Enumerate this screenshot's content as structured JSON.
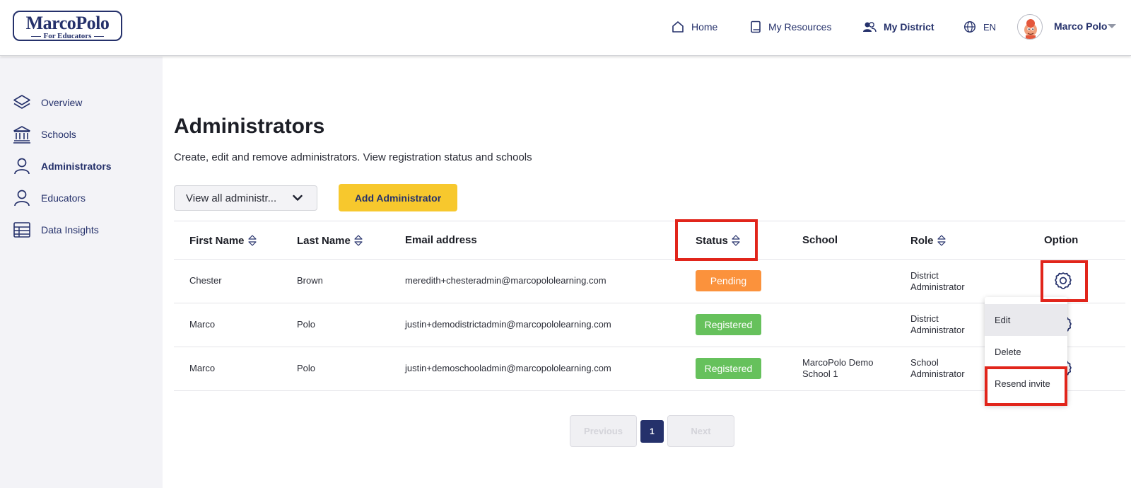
{
  "brand": {
    "name": "MarcoPolo",
    "tagline": "For Educators"
  },
  "nav": {
    "home": "Home",
    "resources": "My Resources",
    "district": "My District",
    "language": "EN",
    "user_name": "Marco Polo"
  },
  "sidebar": {
    "items": [
      {
        "label": "Overview",
        "icon": "layers-icon"
      },
      {
        "label": "Schools",
        "icon": "institution-icon"
      },
      {
        "label": "Administrators",
        "icon": "user-icon",
        "active": true
      },
      {
        "label": "Educators",
        "icon": "user-icon"
      },
      {
        "label": "Data Insights",
        "icon": "table-icon"
      }
    ]
  },
  "page": {
    "title": "Administrators",
    "description": "Create, edit and remove administrators. View registration status and schools",
    "filter_value": "View all administr...",
    "add_button": "Add Administrator"
  },
  "table": {
    "columns": [
      "First Name",
      "Last Name",
      "Email address",
      "Status",
      "School",
      "Role",
      "Option"
    ],
    "rows": [
      {
        "first": "Chester",
        "last": "Brown",
        "email": "meredith+chesteradmin@marcopololearning.com",
        "status": "Pending",
        "school": "",
        "role_line1": "District",
        "role_line2": "Administrator"
      },
      {
        "first": "Marco",
        "last": "Polo",
        "email": "justin+demodistrictadmin@marcopololearning.com",
        "status": "Registered",
        "school": "",
        "role_line1": "District",
        "role_line2": "Administrator"
      },
      {
        "first": "Marco",
        "last": "Polo",
        "email": "justin+demoschooladmin@marcopololearning.com",
        "status": "Registered",
        "school_line1": "MarcoPolo Demo",
        "school_line2": "School 1",
        "role_line1": "School",
        "role_line2": "Administrator"
      }
    ]
  },
  "option_menu": {
    "items": [
      "Edit",
      "Delete",
      "Resend invite"
    ]
  },
  "pagination": {
    "previous": "Previous",
    "current": "1",
    "next": "Next"
  },
  "colors": {
    "brand_navy": "#25316b",
    "accent_yellow": "#f7c82d",
    "pending": "#fb923c",
    "registered": "#66c15c",
    "highlight": "#e1251b"
  }
}
